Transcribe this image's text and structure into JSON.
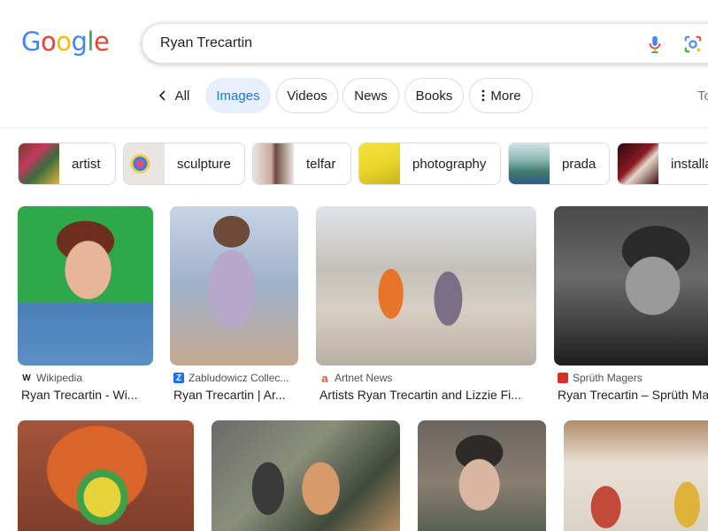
{
  "search": {
    "query": "Ryan Trecartin"
  },
  "logo": {
    "letters": [
      "G",
      "o",
      "o",
      "g",
      "l",
      "e"
    ],
    "colors": [
      "#4285F4",
      "#EA4335",
      "#FBBC05",
      "#4285F4",
      "#34A853",
      "#EA4335"
    ]
  },
  "tabs": {
    "back_icon": "chevron-left-icon",
    "all": "All",
    "images": "Images",
    "videos": "Videos",
    "news": "News",
    "books": "Books",
    "more": "More",
    "tools": "To"
  },
  "chips": [
    "artist",
    "sculpture",
    "telfar",
    "photography",
    "prada",
    "installa"
  ],
  "results_row1": [
    {
      "source": "Wikipedia",
      "title": "Ryan Trecartin - Wi..."
    },
    {
      "source": "Zabludowicz Collec...",
      "title": "Ryan Trecartin | Ar..."
    },
    {
      "source": "Artnet News",
      "title": "Artists Ryan Trecartin and Lizzie Fi..."
    },
    {
      "source": "Sprüth Magers",
      "title": "Ryan Trecartin – Sprüth Ma"
    }
  ],
  "colors": {
    "accent": "#1a73e8",
    "active_tab_bg": "#e8f0fe"
  }
}
